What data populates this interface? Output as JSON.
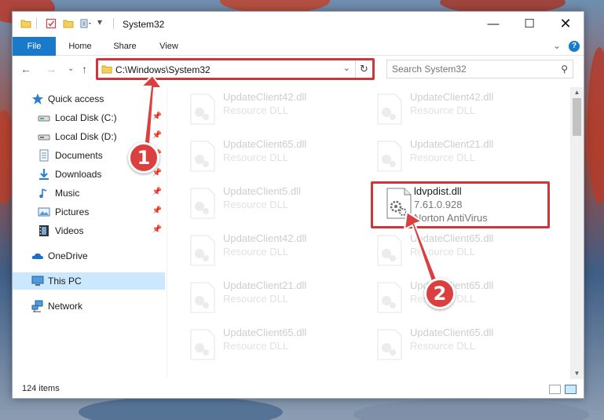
{
  "window": {
    "title": "System32"
  },
  "ribbon": {
    "tabs": [
      "File",
      "Home",
      "Share",
      "View"
    ]
  },
  "address": {
    "path": "C:\\Windows\\System32"
  },
  "search": {
    "placeholder": "Search System32"
  },
  "sidebar": {
    "items": [
      {
        "label": "Quick access",
        "icon": "star-icon"
      },
      {
        "label": "Local Disk (C:)",
        "icon": "drive-icon",
        "pinned": true
      },
      {
        "label": "Local Disk (D:)",
        "icon": "drive-icon",
        "pinned": true
      },
      {
        "label": "Documents",
        "icon": "documents-icon",
        "pinned": true
      },
      {
        "label": "Downloads",
        "icon": "download-icon",
        "pinned": true
      },
      {
        "label": "Music",
        "icon": "music-icon",
        "pinned": true
      },
      {
        "label": "Pictures",
        "icon": "pictures-icon",
        "pinned": true
      },
      {
        "label": "Videos",
        "icon": "videos-icon",
        "pinned": true
      },
      {
        "label": "OneDrive",
        "icon": "cloud-icon"
      },
      {
        "label": "This PC",
        "icon": "computer-icon",
        "selected": true
      },
      {
        "label": "Network",
        "icon": "network-icon"
      }
    ]
  },
  "files": [
    {
      "name": "UpdateClient42.dll",
      "desc": "Resource DLL"
    },
    {
      "name": "UpdateClient42.dll",
      "desc": "Resource DLL"
    },
    {
      "name": "UpdateClient65.dll",
      "desc": "Resource DLL"
    },
    {
      "name": "UpdateClient21.dll",
      "desc": "Resource DLL"
    },
    {
      "name": "UpdateClient5.dll",
      "desc": "Resource DLL"
    },
    {
      "name": "ldvpdist.dll",
      "desc": "7.61.0.928",
      "desc2": "Norton AntiVirus",
      "highlighted": true
    },
    {
      "name": "UpdateClient42.dll",
      "desc": "Resource DLL"
    },
    {
      "name": "UpdateClient65.dll",
      "desc": "Resource DLL"
    },
    {
      "name": "UpdateClient21.dll",
      "desc": "Resource DLL"
    },
    {
      "name": "UpdateClient65.dll",
      "desc": "Resource DLL"
    },
    {
      "name": "UpdateClient65.dll",
      "desc": "Resource DLL"
    },
    {
      "name": "UpdateClient65.dll",
      "desc": "Resource DLL"
    }
  ],
  "status": {
    "count": "124 items"
  },
  "annotations": {
    "badge1": "1",
    "badge2": "2"
  },
  "colors": {
    "accent": "#1979ca",
    "highlight": "#d0353a",
    "selected": "#cce8ff"
  }
}
